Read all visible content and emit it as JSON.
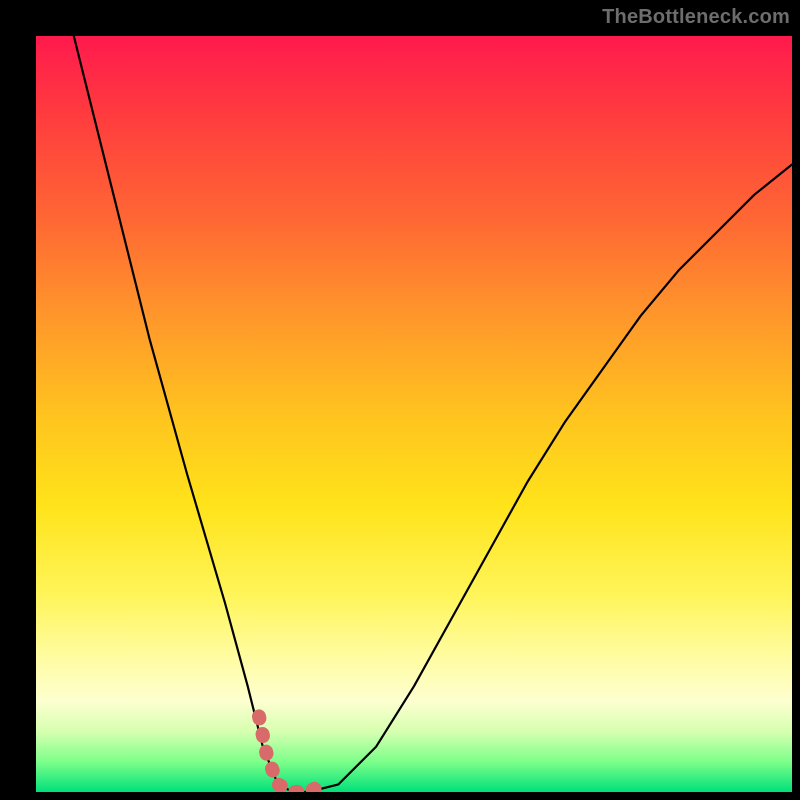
{
  "watermark": "TheBottleneck.com",
  "chart_data": {
    "type": "line",
    "title": "",
    "xlabel": "",
    "ylabel": "",
    "xlim": [
      0,
      100
    ],
    "ylim": [
      0,
      100
    ],
    "grid": false,
    "legend": false,
    "background_gradient": {
      "direction": "top-to-bottom",
      "stops": [
        {
          "pos": 0.0,
          "color": "#ff1a4d"
        },
        {
          "pos": 0.25,
          "color": "#ff6a33"
        },
        {
          "pos": 0.5,
          "color": "#ffc31f"
        },
        {
          "pos": 0.75,
          "color": "#fff55a"
        },
        {
          "pos": 0.9,
          "color": "#d6ffb0"
        },
        {
          "pos": 1.0,
          "color": "#00e07a"
        }
      ]
    },
    "series": [
      {
        "name": "bottleneck-curve",
        "color": "#000000",
        "x": [
          5,
          10,
          15,
          20,
          25,
          28,
          30,
          32,
          34,
          36,
          40,
          45,
          50,
          55,
          60,
          65,
          70,
          75,
          80,
          85,
          90,
          95,
          100
        ],
        "y": [
          100,
          80,
          60,
          42,
          25,
          14,
          6,
          1,
          0,
          0,
          1,
          6,
          14,
          23,
          32,
          41,
          49,
          56,
          63,
          69,
          74,
          79,
          83
        ]
      },
      {
        "name": "highlight-segment",
        "color": "#d86a6a",
        "stroke_width": 12,
        "x": [
          29.5,
          30.5,
          32,
          34,
          36,
          38
        ],
        "y": [
          10,
          5,
          1,
          0,
          0,
          1
        ]
      }
    ],
    "minimum": {
      "x": 34,
      "y": 0
    }
  }
}
